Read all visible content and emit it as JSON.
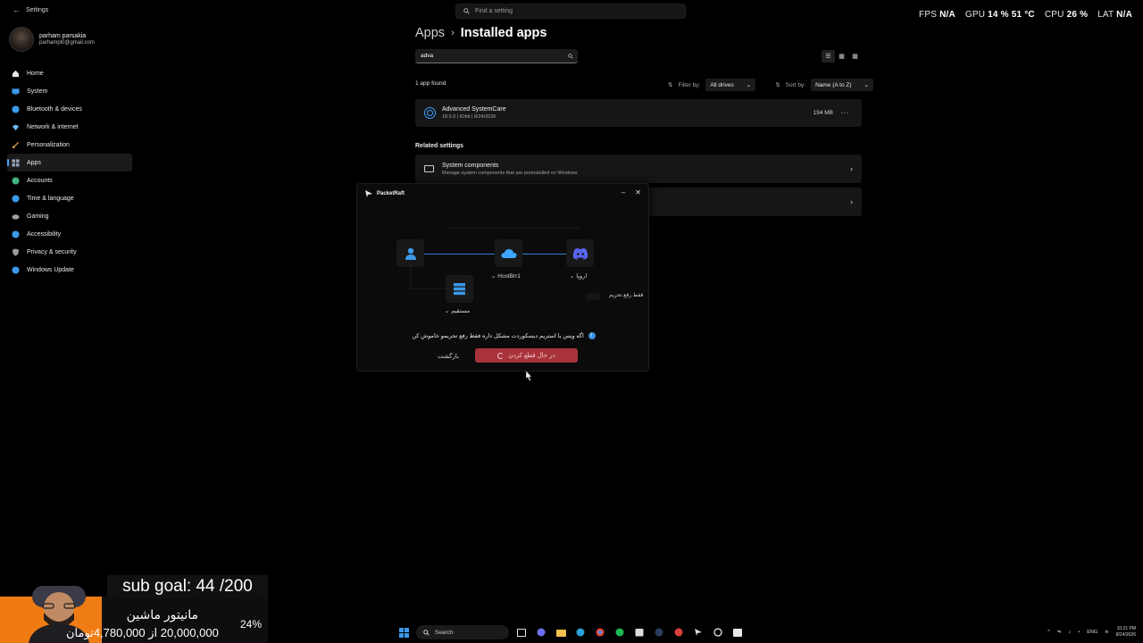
{
  "window": {
    "title": "Settings",
    "back_glyph": "←"
  },
  "search": {
    "placeholder": "Find a setting"
  },
  "stats": [
    {
      "label": "FPS",
      "value": "N/A"
    },
    {
      "label": "GPU",
      "value": "14 % 51 °C"
    },
    {
      "label": "CPU",
      "value": "26 %"
    },
    {
      "label": "LAT",
      "value": "N/A"
    }
  ],
  "profile": {
    "name": "parham parsakia",
    "email": "parhampl0@gmail.com"
  },
  "sidebar": {
    "items": [
      {
        "label": "Home",
        "icon": "home-icon",
        "color": "#e6e6e6"
      },
      {
        "label": "System",
        "icon": "system-icon",
        "color": "#3b9aea"
      },
      {
        "label": "Bluetooth & devices",
        "icon": "bluetooth-icon",
        "color": "#3b9aea"
      },
      {
        "label": "Network & internet",
        "icon": "wifi-icon",
        "color": "#6fb7f0"
      },
      {
        "label": "Personalization",
        "icon": "brush-icon",
        "color": "#e59a4d"
      },
      {
        "label": "Apps",
        "icon": "apps-icon",
        "color": "#8fa0b8"
      },
      {
        "label": "Accounts",
        "icon": "person-icon",
        "color": "#43b37a"
      },
      {
        "label": "Time & language",
        "icon": "globe-icon",
        "color": "#3b9aea"
      },
      {
        "label": "Gaming",
        "icon": "gamepad-icon",
        "color": "#a0a0a0"
      },
      {
        "label": "Accessibility",
        "icon": "accessibility-icon",
        "color": "#3b9aea"
      },
      {
        "label": "Privacy & security",
        "icon": "shield-icon",
        "color": "#9a9a9a"
      },
      {
        "label": "Windows Update",
        "icon": "update-icon",
        "color": "#3b9aea"
      }
    ],
    "active_index": 5
  },
  "main": {
    "breadcrumb": [
      "Apps",
      "Installed apps"
    ],
    "breadcrumb_sep": "›",
    "search_value": "adva",
    "found_text": "1 app found",
    "filter_label": "Filter by:",
    "filter_value": "All drives",
    "sort_label": "Sort by:",
    "sort_value": "Name (A to Z)",
    "dropdown_chevron": "⌄",
    "app": {
      "name": "Advanced SystemCare",
      "meta": "18.5.0  |  IObit  |  8/24/2026",
      "size": "194 MB",
      "more": "···"
    },
    "related_title": "Related settings",
    "related": [
      {
        "title": "System components",
        "desc": "Manage system components that are preinstalled on Windows"
      }
    ],
    "chevron": "›"
  },
  "dialog": {
    "title": "PacketRaft",
    "minimize": "–",
    "close": "✕",
    "node_labels": {
      "server": "HostBrr1",
      "dest": "اروپا",
      "direct": "مستقیم"
    },
    "toggle_label": "فقط رفع تحریم",
    "warning": "اگه ویس یا استریم دیسکوردت مشکل داره فقط رفع تحریمو خاموش کن",
    "info_glyph": "i",
    "back_button": "بازگشت",
    "disconnect_button": "در حال قطع کردن"
  },
  "overlay": {
    "goal_text": "sub goal: 44 /200",
    "title": "مانیتور ماشین",
    "progress_text": "20,000,000 از 4,780,000تومان",
    "percent": "24%"
  },
  "taskbar": {
    "search_label": "Search",
    "lang": "ENG",
    "time": "10:21 PM",
    "date": "8/24/2026"
  }
}
